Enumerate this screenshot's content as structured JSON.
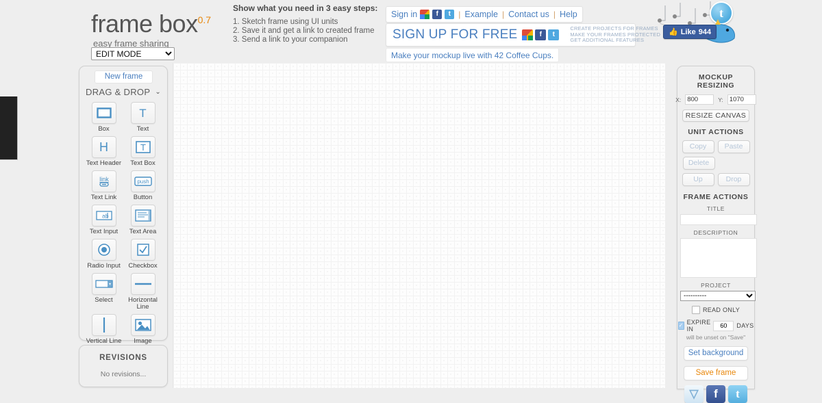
{
  "brand": {
    "name": "frame box",
    "version": "0.7",
    "tagline": "easy frame sharing",
    "mode": "EDIT MODE"
  },
  "steps": {
    "heading": "Show what you need in 3 easy steps:",
    "items": [
      "1. Sketch frame using UI units",
      "2. Save it and get a link to created frame",
      "3. Send a link to your companion"
    ]
  },
  "signin": {
    "label": "Sign in",
    "links": [
      "Example",
      "Contact us",
      "Help"
    ],
    "separator": "|"
  },
  "signup": {
    "title": "SIGN UP FOR FREE",
    "benefits": [
      "CREATE PROJECTS FOR FRAMES",
      "MAKE YOUR FRAMES PROTECTED",
      "GET ADDITIONAL FEATURES"
    ]
  },
  "promo": {
    "text": "Make your mockup live with 42 Coffee Cups."
  },
  "social": {
    "like_label": "Like",
    "like_count": "944",
    "twitter_glyph": "t"
  },
  "toolbox": {
    "new_frame": "New frame",
    "section": "DRAG & DROP",
    "chevron": "⌄",
    "tools": [
      {
        "label": "Box",
        "icon": "box-icon",
        "glyph": "▭"
      },
      {
        "label": "Text",
        "icon": "text-icon",
        "glyph": "T"
      },
      {
        "label": "Text Header",
        "icon": "text-header-icon",
        "glyph": "H"
      },
      {
        "label": "Text Box",
        "icon": "text-box-icon",
        "glyph": "T"
      },
      {
        "label": "Text Link",
        "icon": "text-link-icon",
        "glyph": "link"
      },
      {
        "label": "Button",
        "icon": "button-icon",
        "glyph": "push"
      },
      {
        "label": "Text Input",
        "icon": "text-input-icon",
        "glyph": "ab|"
      },
      {
        "label": "Text Area",
        "icon": "text-area-icon",
        "glyph": "≡"
      },
      {
        "label": "Radio Input",
        "icon": "radio-input-icon",
        "glyph": "◉"
      },
      {
        "label": "Checkbox",
        "icon": "checkbox-icon",
        "glyph": "✓"
      },
      {
        "label": "Select",
        "icon": "select-icon",
        "glyph": "▾"
      },
      {
        "label": "Horizontal Line",
        "icon": "horizontal-line-icon",
        "glyph": "—"
      },
      {
        "label": "Vertical Line",
        "icon": "vertical-line-icon",
        "glyph": "|"
      },
      {
        "label": "Image",
        "icon": "image-icon",
        "glyph": "☒"
      }
    ]
  },
  "revisions": {
    "title": "REVISIONS",
    "empty": "No revisions..."
  },
  "rightpanel": {
    "resizing_title": "MOCKUP RESIZING",
    "x_label": "X:",
    "x_value": "800",
    "y_label": "Y:",
    "y_value": "1070",
    "resize_button": "RESIZE CANVAS",
    "unit_actions_title": "UNIT ACTIONS",
    "unit_actions": [
      "Copy",
      "Paste",
      "Delete",
      "Up",
      "Drop"
    ],
    "frame_actions_title": "FRAME ACTIONS",
    "title_label": "TITLE",
    "title_value": "",
    "description_label": "DESCRIPTION",
    "description_value": "",
    "project_label": "PROJECT",
    "project_value": "----------",
    "read_only_label": "READ ONLY",
    "expire_prefix": "EXPIRE IN",
    "expire_days": "60",
    "expire_suffix": "DAYS",
    "expire_hint": "will be unset on \"Save\"",
    "set_background": "Set background",
    "save_frame": "Save frame"
  },
  "colors": {
    "accent_blue": "#4a7fbf",
    "accent_orange": "#e8870c",
    "icon_blue": "#4a90c4",
    "page_bg": "#eeeeee"
  }
}
